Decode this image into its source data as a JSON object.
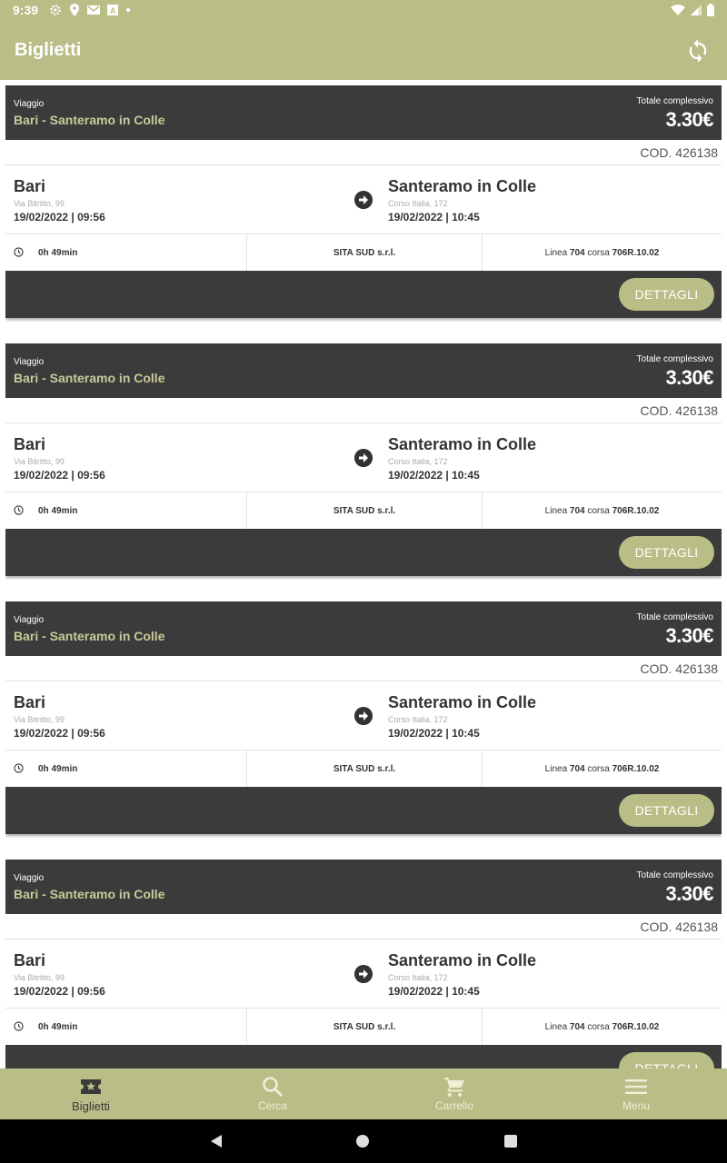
{
  "status_bar": {
    "time": "9:39",
    "icons": [
      "settings-icon",
      "location-icon",
      "gmail-icon",
      "a-icon",
      "dot-icon"
    ],
    "right_icons": [
      "wifi-icon",
      "signal-icon",
      "battery-icon"
    ]
  },
  "app_bar": {
    "title": "Biglietti",
    "refresh_icon": "refresh-icon"
  },
  "tickets": [
    {
      "trip_label": "Viaggio",
      "route": "Bari - Santeramo in Colle",
      "total_label": "Totale complessivo",
      "price": "3.30€",
      "code": "COD. 426138",
      "from_city": "Bari",
      "from_address": "Via Bitritto, 99",
      "from_datetime": "19/02/2022 | 09:56",
      "to_city": "Santeramo in Colle",
      "to_address": "Corso Italia, 172",
      "to_datetime": "19/02/2022 | 10:45",
      "duration": "0h 49min",
      "company": "SITA SUD s.r.l.",
      "line_prefix": "Linea",
      "line_number": "704",
      "run_prefix": "corsa",
      "run_number": "706R.10.02",
      "button": "DETTAGLI"
    },
    {
      "trip_label": "Viaggio",
      "route": "Bari - Santeramo in Colle",
      "total_label": "Totale complessivo",
      "price": "3.30€",
      "code": "COD. 426138",
      "from_city": "Bari",
      "from_address": "Via Bitritto, 99",
      "from_datetime": "19/02/2022 | 09:56",
      "to_city": "Santeramo in Colle",
      "to_address": "Corso Italia, 172",
      "to_datetime": "19/02/2022 | 10:45",
      "duration": "0h 49min",
      "company": "SITA SUD s.r.l.",
      "line_prefix": "Linea",
      "line_number": "704",
      "run_prefix": "corsa",
      "run_number": "706R.10.02",
      "button": "DETTAGLI"
    },
    {
      "trip_label": "Viaggio",
      "route": "Bari - Santeramo in Colle",
      "total_label": "Totale complessivo",
      "price": "3.30€",
      "code": "COD. 426138",
      "from_city": "Bari",
      "from_address": "Via Bitritto, 99",
      "from_datetime": "19/02/2022 | 09:56",
      "to_city": "Santeramo in Colle",
      "to_address": "Corso Italia, 172",
      "to_datetime": "19/02/2022 | 10:45",
      "duration": "0h 49min",
      "company": "SITA SUD s.r.l.",
      "line_prefix": "Linea",
      "line_number": "704",
      "run_prefix": "corsa",
      "run_number": "706R.10.02",
      "button": "DETTAGLI"
    },
    {
      "trip_label": "Viaggio",
      "route": "Bari - Santeramo in Colle",
      "total_label": "Totale complessivo",
      "price": "3.30€",
      "code": "COD. 426138",
      "from_city": "Bari",
      "from_address": "Via Bitritto, 99",
      "from_datetime": "19/02/2022 | 09:56",
      "to_city": "Santeramo in Colle",
      "to_address": "Corso Italia, 172",
      "to_datetime": "19/02/2022 | 10:45",
      "duration": "0h 49min",
      "company": "SITA SUD s.r.l.",
      "line_prefix": "Linea",
      "line_number": "704",
      "run_prefix": "corsa",
      "run_number": "706R.10.02",
      "button": "DETTAGLI"
    }
  ],
  "bottom_nav": [
    {
      "label": "Biglietti",
      "icon": "ticket-icon",
      "active": true
    },
    {
      "label": "Cerca",
      "icon": "search-icon",
      "active": false
    },
    {
      "label": "Carrello",
      "icon": "cart-icon",
      "active": false
    },
    {
      "label": "Menu",
      "icon": "menu-icon",
      "active": false
    }
  ],
  "colors": {
    "accent": "#b9bd86",
    "dark": "#3b3b3b",
    "route_text": "#c8cb98"
  }
}
